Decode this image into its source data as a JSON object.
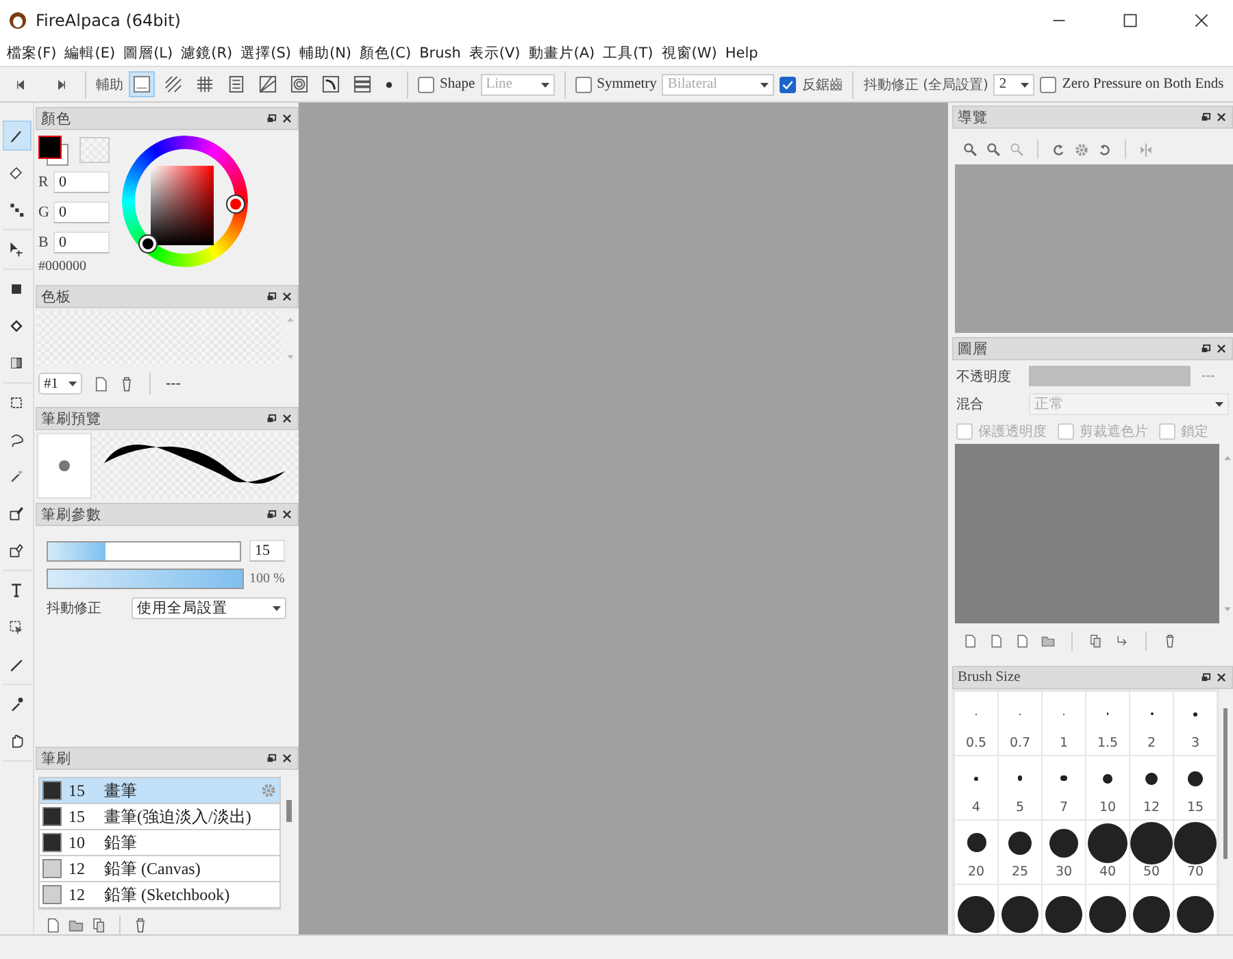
{
  "window": {
    "title": "FireAlpaca (64bit)"
  },
  "menu": [
    "檔案(F)",
    "編輯(E)",
    "圖層(L)",
    "濾鏡(R)",
    "選擇(S)",
    "輔助(N)",
    "顏色(C)",
    "Brush",
    "表示(V)",
    "動畫片(A)",
    "工具(T)",
    "視窗(W)",
    "Help"
  ],
  "toolbar": {
    "guide_label": "輔助",
    "guide_modes": [
      {
        "selected": true
      },
      {
        "selected": false
      },
      {
        "selected": false
      },
      {
        "selected": false
      },
      {
        "selected": false
      },
      {
        "selected": false
      },
      {
        "selected": false
      },
      {
        "selected": false
      }
    ],
    "shape": {
      "label": "Shape",
      "checked": false,
      "value": "Line"
    },
    "symmetry": {
      "label": "Symmetry",
      "checked": false,
      "value": "Bilateral"
    },
    "antialias": {
      "label": "反鋸齒",
      "checked": true
    },
    "stabilizer": {
      "label": "抖動修正 (全局設置)",
      "value": "2"
    },
    "zero_pressure": {
      "label": "Zero Pressure on Both Ends",
      "checked": false
    }
  },
  "tool_groups": [
    [
      {
        "selected": true
      },
      {
        "selected": false
      },
      {
        "selected": false
      }
    ],
    [
      {
        "selected": false
      }
    ],
    [
      {
        "selected": false
      },
      {
        "selected": false
      },
      {
        "selected": false
      }
    ],
    [
      {
        "selected": false
      },
      {
        "selected": false
      },
      {
        "selected": false
      },
      {
        "selected": false
      },
      {
        "selected": false
      }
    ],
    [
      {
        "selected": false
      },
      {
        "selected": false
      },
      {
        "selected": false
      }
    ],
    [
      {
        "selected": false
      },
      {
        "selected": false
      }
    ]
  ],
  "color_panel": {
    "title": "顏色",
    "channels": [
      {
        "label": "R",
        "value": "0"
      },
      {
        "label": "G",
        "value": "0"
      },
      {
        "label": "B",
        "value": "0"
      }
    ],
    "hex": "#000000"
  },
  "palette_panel": {
    "title": "色板",
    "set": "#1",
    "count": "---"
  },
  "brush_preview_panel": {
    "title": "筆刷預覽"
  },
  "brush_params_panel": {
    "title": "筆刷參數",
    "size": {
      "level": 0.3,
      "value": "15"
    },
    "opacity": {
      "level": 1,
      "value": "100 %"
    },
    "stabilizer": {
      "label": "抖動修正",
      "value": "使用全局設置"
    }
  },
  "brushes_panel": {
    "title": "筆刷",
    "items": [
      {
        "size": "15",
        "name": "畫筆",
        "selected": true,
        "color": "#2b2b2b"
      },
      {
        "size": "15",
        "name": "畫筆(強迫淡入/淡出)",
        "selected": false,
        "color": "#2b2b2b"
      },
      {
        "size": "10",
        "name": "鉛筆",
        "selected": false,
        "color": "#2b2b2b"
      },
      {
        "size": "12",
        "name": "鉛筆 (Canvas)",
        "selected": false,
        "color": "#d0d0d0"
      },
      {
        "size": "12",
        "name": "鉛筆 (Sketchbook)",
        "selected": false,
        "color": "#d0d0d0"
      }
    ]
  },
  "navigator_panel": {
    "title": "導覽"
  },
  "layers_panel": {
    "title": "圖層",
    "opacity": {
      "label": "不透明度",
      "level": 1,
      "value": "---"
    },
    "blend": {
      "label": "混合",
      "value": "正常"
    },
    "options": [
      {
        "label": "保護透明度",
        "checked": false,
        "disabled": true
      },
      {
        "label": "剪裁遮色片",
        "checked": false,
        "disabled": true
      },
      {
        "label": "鎖定",
        "checked": false,
        "disabled": true
      }
    ]
  },
  "brush_size_panel": {
    "title": "Brush Size",
    "sizes": [
      "0.5",
      "0.7",
      "1",
      "1.5",
      "2",
      "3",
      "4",
      "5",
      "7",
      "10",
      "12",
      "15",
      "20",
      "25",
      "30",
      "40",
      "50",
      "70"
    ]
  }
}
